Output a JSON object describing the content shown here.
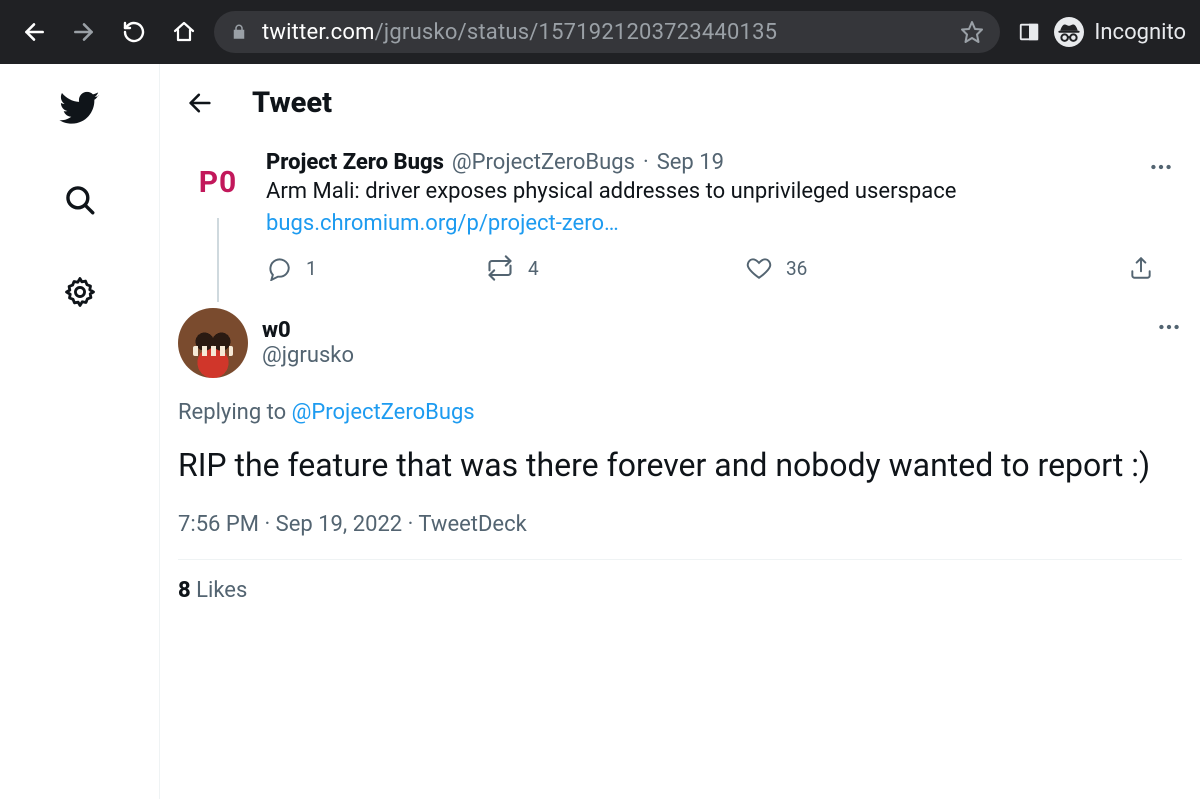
{
  "browser": {
    "url_host": "twitter.com",
    "url_path": "/jgrusko/status/1571921203723440135",
    "incognito_label": "Incognito"
  },
  "header": {
    "title": "Tweet"
  },
  "parent": {
    "avatar_text": "P0",
    "display_name": "Project Zero Bugs",
    "handle": "@ProjectZeroBugs",
    "date": "Sep 19",
    "text": "Arm Mali: driver exposes physical addresses to unprivileged userspace",
    "link_text": "bugs.chromium.org/p/project-zero…",
    "replies": "1",
    "retweets": "4",
    "likes": "36"
  },
  "tweet": {
    "display_name": "w0",
    "handle": "@jgrusko",
    "replying_prefix": "Replying to ",
    "replying_to": "@ProjectZeroBugs",
    "body": "RIP the feature that was there forever and nobody wanted to report :)",
    "time": "7:56 PM",
    "date": "Sep 19, 2022",
    "source": "TweetDeck",
    "likes_count": "8",
    "likes_label": "Likes"
  }
}
